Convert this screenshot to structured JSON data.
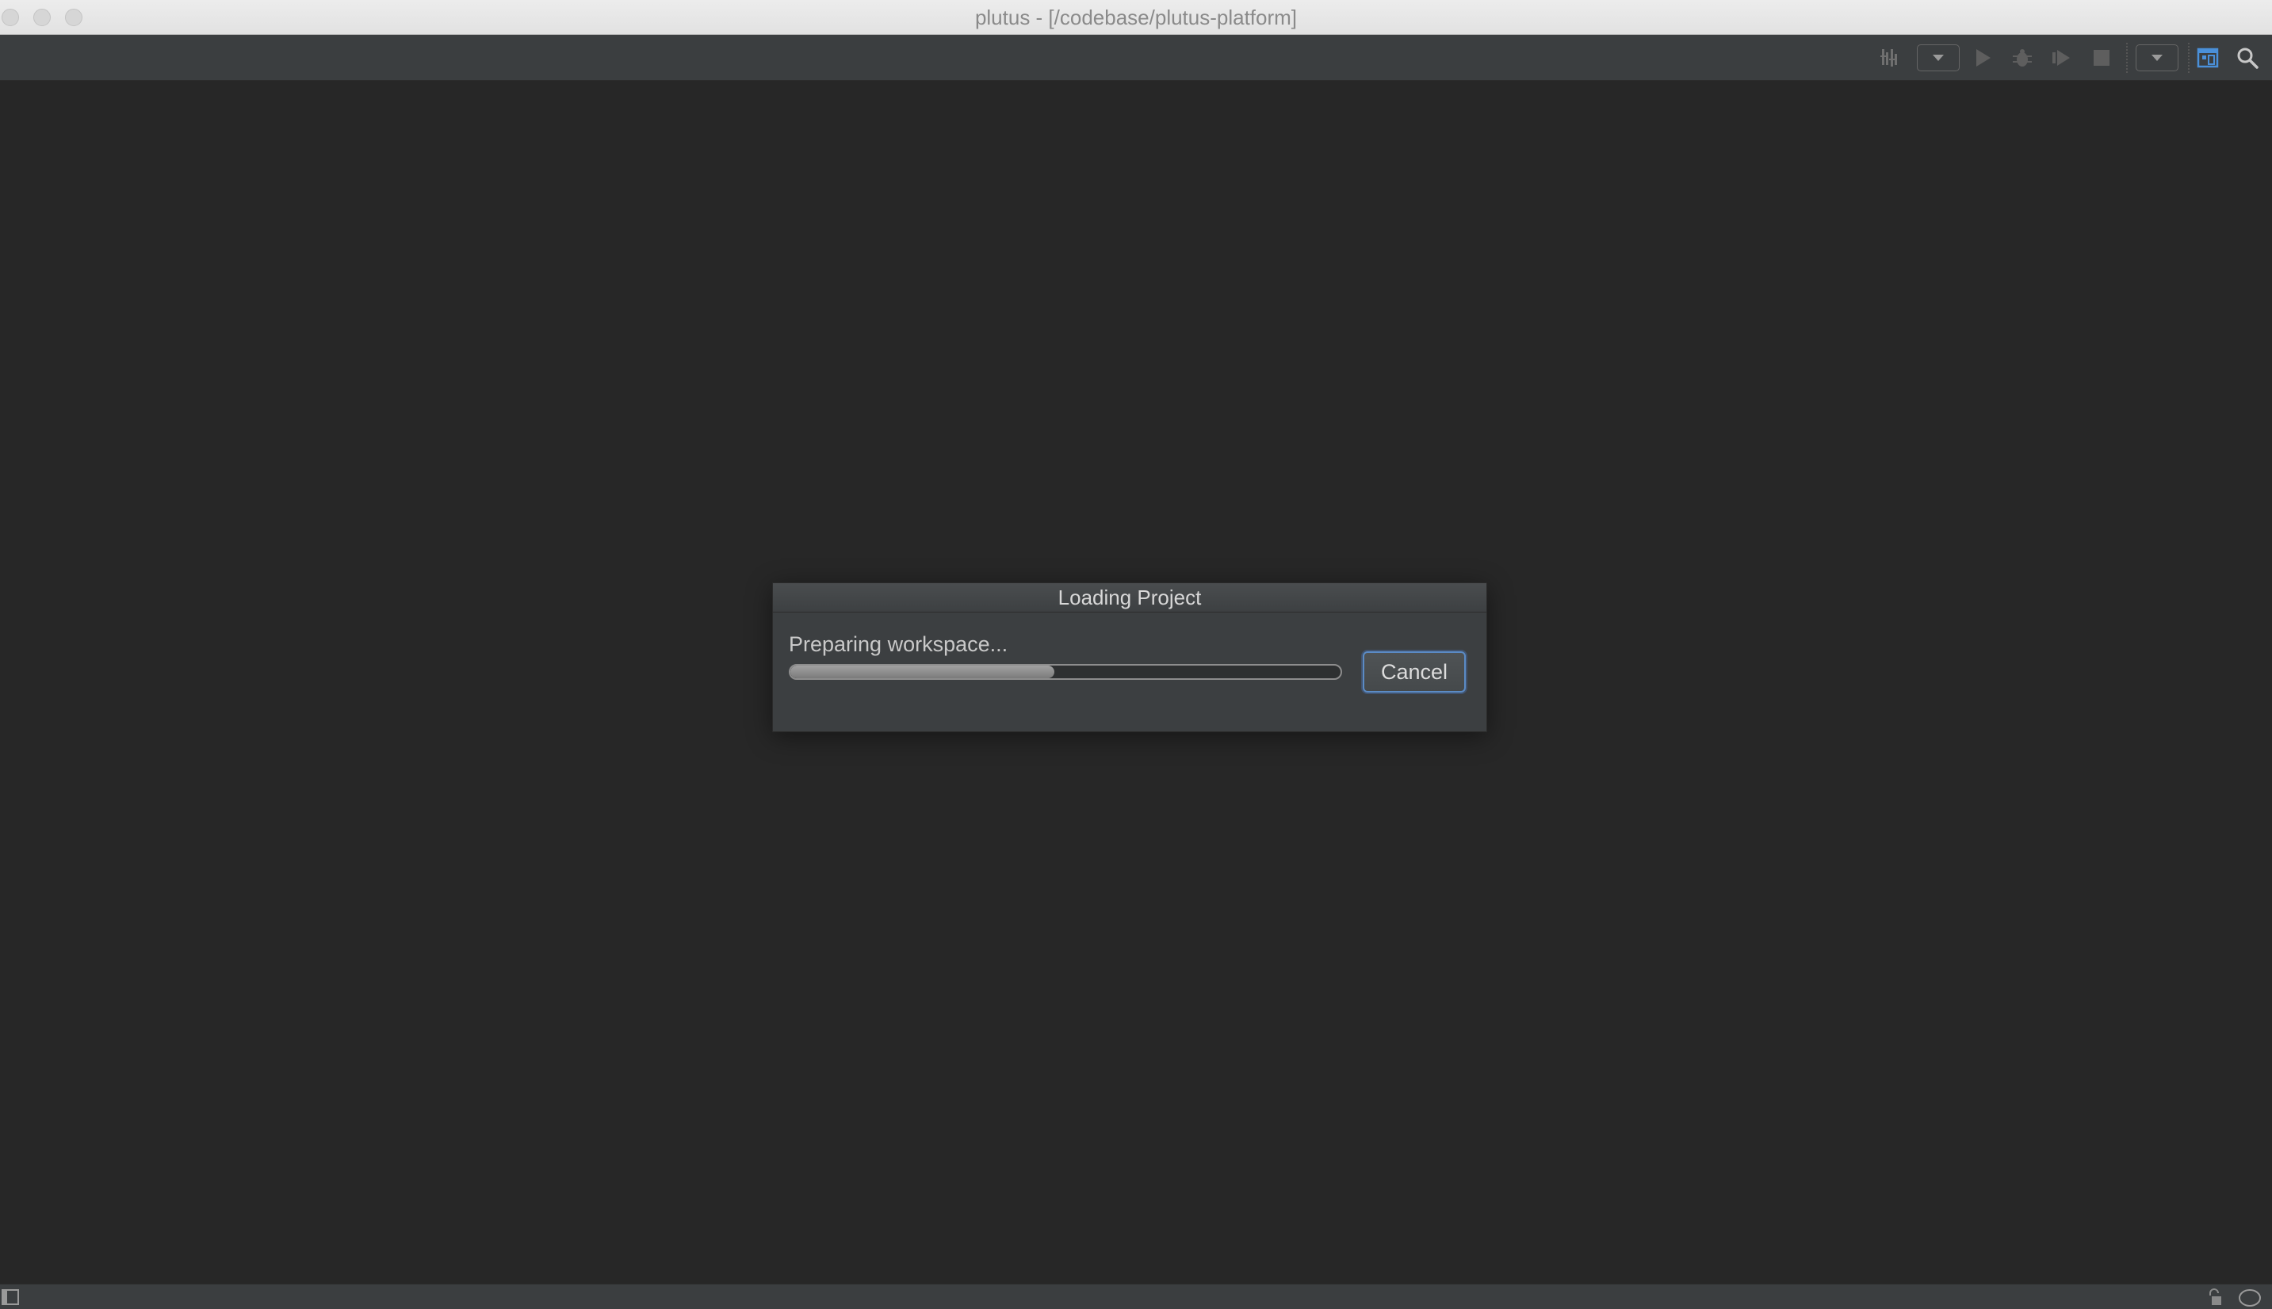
{
  "window": {
    "title": "plutus - [/codebase/plutus-platform]"
  },
  "toolbar": {
    "icons": [
      "build-icon",
      "run-configuration-dropdown",
      "run-icon",
      "debug-icon",
      "coverage-icon",
      "stop-icon",
      "vcs-dropdown",
      "project-structure-icon",
      "search-icon"
    ]
  },
  "dialog": {
    "title": "Loading Project",
    "status_text": "Preparing workspace...",
    "progress_fraction": 0.48,
    "cancel_label": "Cancel"
  },
  "statusbar": {
    "icons": [
      "tool-windows-icon",
      "lock-icon",
      "notifications-icon"
    ]
  },
  "colors": {
    "background": "#272727",
    "toolbar": "#3b3e40",
    "dialog": "#3c3f41",
    "accent_focus": "#5b8bc5",
    "project_structure_icon": "#4a90d9"
  }
}
